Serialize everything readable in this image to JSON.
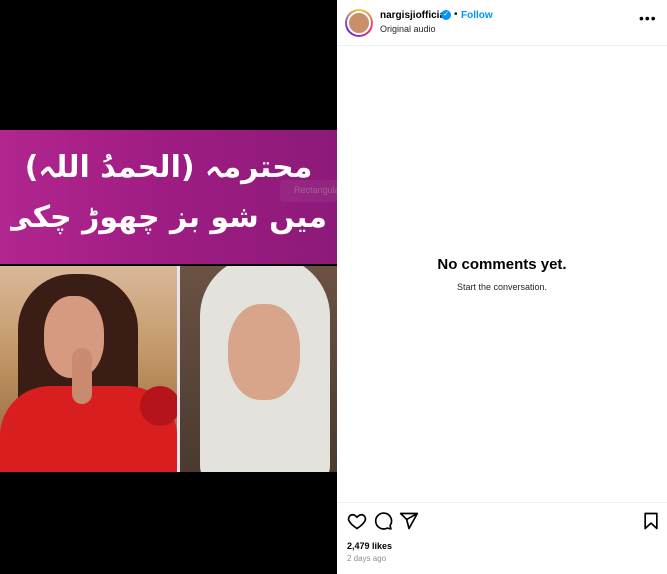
{
  "post": {
    "username": "nargisjiofficial",
    "verified_mark": "✓",
    "separator": "•",
    "follow_label": "Follow",
    "audio_label": "Original audio",
    "more_label": "•••"
  },
  "media": {
    "overlay_line_1": "محترمہ (الحمدُ اللہ)",
    "overlay_line_2": "میں شو بز چھوڑ چکی ہوں",
    "ghost_text": "Rectangular Snip"
  },
  "comments": {
    "empty_title": "No comments yet.",
    "empty_subtitle": "Start the conversation."
  },
  "actions": {
    "likes": "2,479 likes",
    "time": "2 days ago"
  },
  "colors": {
    "accent": "#0095f6",
    "banner": "#a01d83"
  },
  "icons": [
    "heart-icon",
    "comment-icon",
    "share-icon",
    "bookmark-icon",
    "more-icon",
    "verified-badge-icon"
  ]
}
